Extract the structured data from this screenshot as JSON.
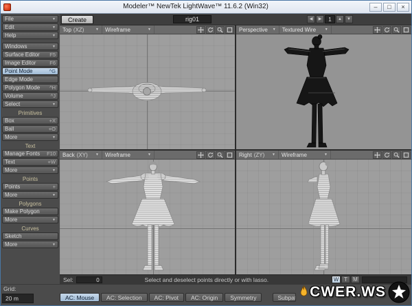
{
  "window": {
    "title": "Modeler™ NewTek LightWave™ 11.6.2 (Win32)"
  },
  "icons": {
    "minimize": "–",
    "maximize": "□",
    "close": "×",
    "dropdown": "▼",
    "prev": "◀",
    "next": "▶",
    "up": "▲",
    "down": "▼"
  },
  "toolbar": {
    "tabs": [
      {
        "label": "Create",
        "active": true
      }
    ],
    "object_name": "rig01",
    "layer_number": "1"
  },
  "sidebar": {
    "sections": [
      {
        "items": [
          {
            "label": "File",
            "dropdown": true
          },
          {
            "label": "Edit",
            "dropdown": true
          },
          {
            "label": "Help",
            "dropdown": true
          }
        ]
      },
      {
        "items": [
          {
            "label": "Windows",
            "dropdown": true
          },
          {
            "label": "Surface Editor",
            "shortcut": "F5"
          },
          {
            "label": "Image Editor",
            "shortcut": "F6"
          },
          {
            "label": "Point Mode",
            "shortcut": "^G",
            "active": true
          },
          {
            "label": "Edge Mode"
          },
          {
            "label": "Polygon Mode",
            "shortcut": "^H"
          },
          {
            "label": "Volume",
            "shortcut": "^J"
          },
          {
            "label": "Select",
            "dropdown": true
          }
        ]
      },
      {
        "title": "Primitives",
        "items": [
          {
            "label": "Box",
            "shortcut": "+X"
          },
          {
            "label": "Ball",
            "shortcut": "+O"
          },
          {
            "label": "More",
            "dropdown": true
          }
        ]
      },
      {
        "title": "Text",
        "items": [
          {
            "label": "Manage Fonts",
            "shortcut": "F10"
          },
          {
            "label": "Text",
            "shortcut": "+W"
          },
          {
            "label": "More",
            "dropdown": true
          }
        ]
      },
      {
        "title": "Points",
        "items": [
          {
            "label": "Points",
            "shortcut": "+"
          },
          {
            "label": "More",
            "dropdown": true
          }
        ]
      },
      {
        "title": "Polygons",
        "items": [
          {
            "label": "Make Polygon"
          },
          {
            "label": "More",
            "dropdown": true
          }
        ]
      },
      {
        "title": "Curves",
        "items": [
          {
            "label": "Sketch"
          },
          {
            "label": "More",
            "dropdown": true
          }
        ]
      }
    ]
  },
  "viewports": [
    {
      "view": "Top",
      "axis": "(XZ)",
      "style": "Wireframe"
    },
    {
      "view": "Perspective",
      "axis": "",
      "style": "Textured Wire"
    },
    {
      "view": "Back",
      "axis": "(XY)",
      "style": "Wireframe"
    },
    {
      "view": "Right",
      "axis": "(ZY)",
      "style": "Wireframe"
    }
  ],
  "selbar": {
    "label": "Sel:",
    "value": "0",
    "hint": "Select and deselect points directly or with lasso.",
    "vmap_buttons": [
      "W",
      "T",
      "M"
    ],
    "active_vmap": "W"
  },
  "statusbar": {
    "grid_label": "Grid:",
    "grid_value": "20 m",
    "buttons": [
      {
        "label": "AC: Mouse",
        "active": true
      },
      {
        "label": "AC: Selection"
      },
      {
        "label": "AC: Pivot"
      },
      {
        "label": "AC: Origin"
      },
      {
        "label": "Symmetry"
      },
      {
        "label": "Subpatch",
        "gap": true,
        "clip": true
      }
    ]
  },
  "watermark": {
    "text": "CWER.WS"
  },
  "colors": {
    "ui_bg": "#4b4b4b",
    "titlebar_bg": "#e9eef6",
    "viewport_bg": "#9e9e9e",
    "active_button": "#a9c6e0",
    "accent_blue": "#8fb2d4"
  }
}
